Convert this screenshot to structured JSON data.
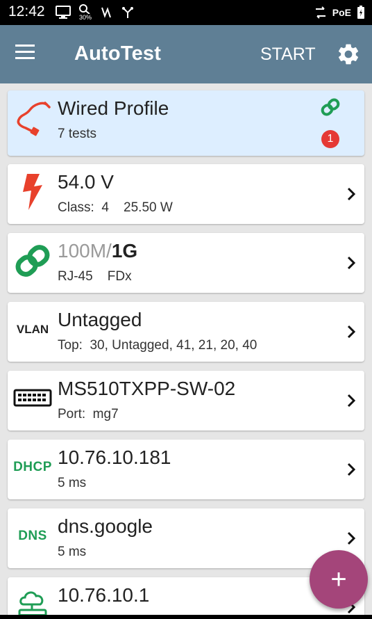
{
  "status_bar": {
    "time": "12:42",
    "battery_percent": "30%",
    "poe": "PoE"
  },
  "app_bar": {
    "title": "AutoTest",
    "start_label": "START"
  },
  "profile": {
    "title": "Wired Profile",
    "subtitle": "7 tests",
    "badge_count": "1"
  },
  "tests": [
    {
      "icon": "lightning-icon",
      "main": "54.0 V",
      "sub": "Class:  4    25.50 W"
    },
    {
      "icon": "link-icon",
      "main_gray": "100M/",
      "main_bold": "1G",
      "sub": "RJ-45    FDx"
    },
    {
      "icon": "vlan-icon",
      "icon_text": "VLAN",
      "main": "Untagged",
      "sub": "Top:  30, Untagged, 41, 21, 20, 40"
    },
    {
      "icon": "switch-icon",
      "main": "MS510TXPP-SW-02",
      "sub": "Port:  mg7"
    },
    {
      "icon": "dhcp-icon",
      "icon_text": "DHCP",
      "main": "10.76.10.181",
      "sub": "5 ms"
    },
    {
      "icon": "dns-icon",
      "icon_text": "DNS",
      "main": "dns.google",
      "sub": "5 ms"
    },
    {
      "icon": "gateway-icon",
      "main": "10.76.10.1",
      "sub": ""
    }
  ],
  "fab": {
    "label": "+"
  },
  "colors": {
    "app_bar": "#5f7f95",
    "profile_bg": "#ddeeff",
    "accent_green": "#1f9d55",
    "alert_red": "#e53935",
    "fab": "#a4457a"
  }
}
